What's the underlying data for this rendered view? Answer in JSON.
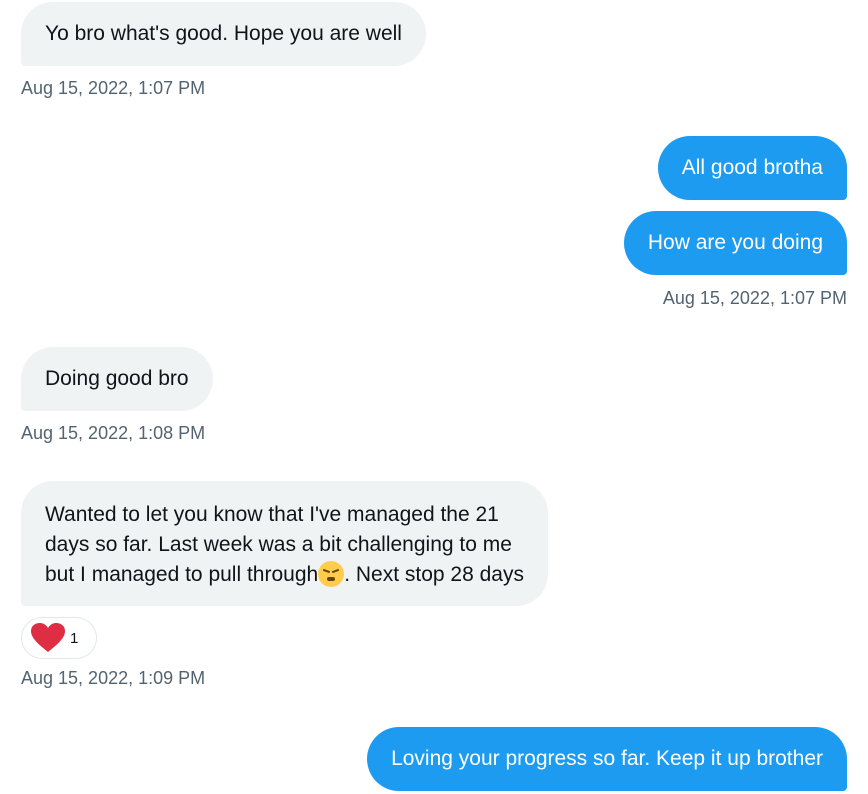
{
  "messages": [
    {
      "text": "Yo bro what's good. Hope you are well",
      "timestamp": "Aug 15, 2022, 1:07 PM"
    },
    {
      "text": "All good brotha"
    },
    {
      "text": "How are you doing",
      "timestamp": "Aug 15, 2022, 1:07 PM"
    },
    {
      "text": "Doing good bro",
      "timestamp": "Aug 15, 2022, 1:08 PM"
    },
    {
      "line1": "Wanted to let you know that I've managed the 21",
      "line2": "days so far. Last week was a bit challenging to me",
      "line3_before_emoji": "but I managed to pull through",
      "line3_after_emoji": ". Next stop 28 days",
      "emoji_icon": "face-with-steam-from-nose-icon",
      "reaction": {
        "icon": "red-heart-icon",
        "count": "1"
      },
      "timestamp": "Aug 15, 2022, 1:09 PM"
    },
    {
      "text": "Loving your progress so far. Keep it up brother"
    }
  ],
  "colors": {
    "outgoing_bubble": "#1d9bf0",
    "incoming_bubble": "#eff3f4",
    "timestamp": "#536471",
    "heart": "#e0245e"
  }
}
